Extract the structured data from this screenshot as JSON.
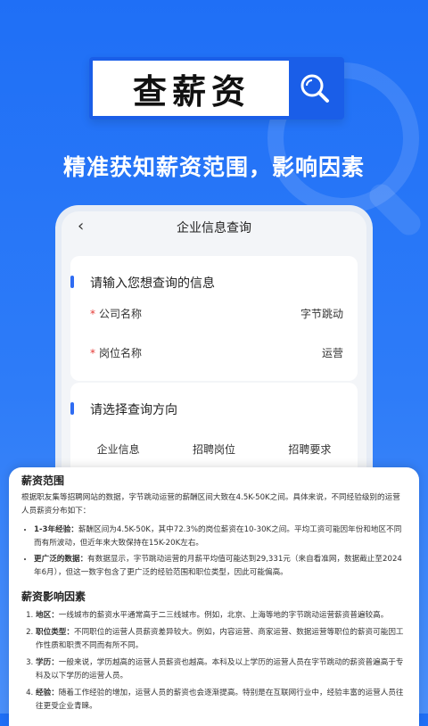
{
  "hero": {
    "title": "查薪资",
    "slogan": "精准获知薪资范围，影响因素"
  },
  "phone": {
    "header_title": "企业信息查询",
    "back_icon": "chevron-left-icon",
    "input_card": {
      "title": "请输入您想查询的信息",
      "fields": [
        {
          "label": "公司名称",
          "value": "字节跳动",
          "required": true
        },
        {
          "label": "岗位名称",
          "value": "运营",
          "required": true
        }
      ]
    },
    "direction_card": {
      "title": "请选择查询方向",
      "options": [
        "企业信息",
        "招聘岗位",
        "招聘要求"
      ]
    }
  },
  "result": {
    "range_title": "薪资范围",
    "range_intro": "根据职友集等招聘网站的数据，字节跳动运营的薪酬区间大致在4.5K-50K之间。具体来说，不同经验级别的运营人员薪资分布如下：",
    "range_items": [
      {
        "key": "1-3年经验：",
        "text": "薪酬区间为4.5K-50K，其中72.3%的岗位薪资在10-30K之间。平均工资可能因年份和地区不同而有所波动，但近年来大致保持在15K-20K左右。"
      },
      {
        "key": "更广泛的数据：",
        "text": "有数据显示，字节跳动运营的月薪平均值可能达到29,331元（来自看准网，数据截止至2024年6月），但这一数字包含了更广泛的经验范围和职位类型，因此可能偏高。"
      }
    ],
    "factors_title": "薪资影响因素",
    "factors": [
      {
        "key": "地区：",
        "text": "一线城市的薪资水平通常高于二三线城市。例如，北京、上海等地的字节跳动运营薪资普遍较高。"
      },
      {
        "key": "职位类型：",
        "text": "不同职位的运营人员薪资差异较大。例如，内容运营、商家运营、数据运营等职位的薪资可能因工作性质和职责不同而有所不同。"
      },
      {
        "key": "学历：",
        "text": "一般来说，学历越高的运营人员薪资也越高。本科及以上学历的运营人员在字节跳动的薪资普遍高于专科及以下学历的运营人员。"
      },
      {
        "key": "经验：",
        "text": "随着工作经验的增加，运营人员的薪资也会逐渐提高。特别是在互联网行业中，经验丰富的运营人员往往更受企业青睐。"
      }
    ]
  },
  "colors": {
    "primary": "#1f6ff6",
    "accent_bar": "#2f6cf2",
    "required": "#e53935"
  }
}
